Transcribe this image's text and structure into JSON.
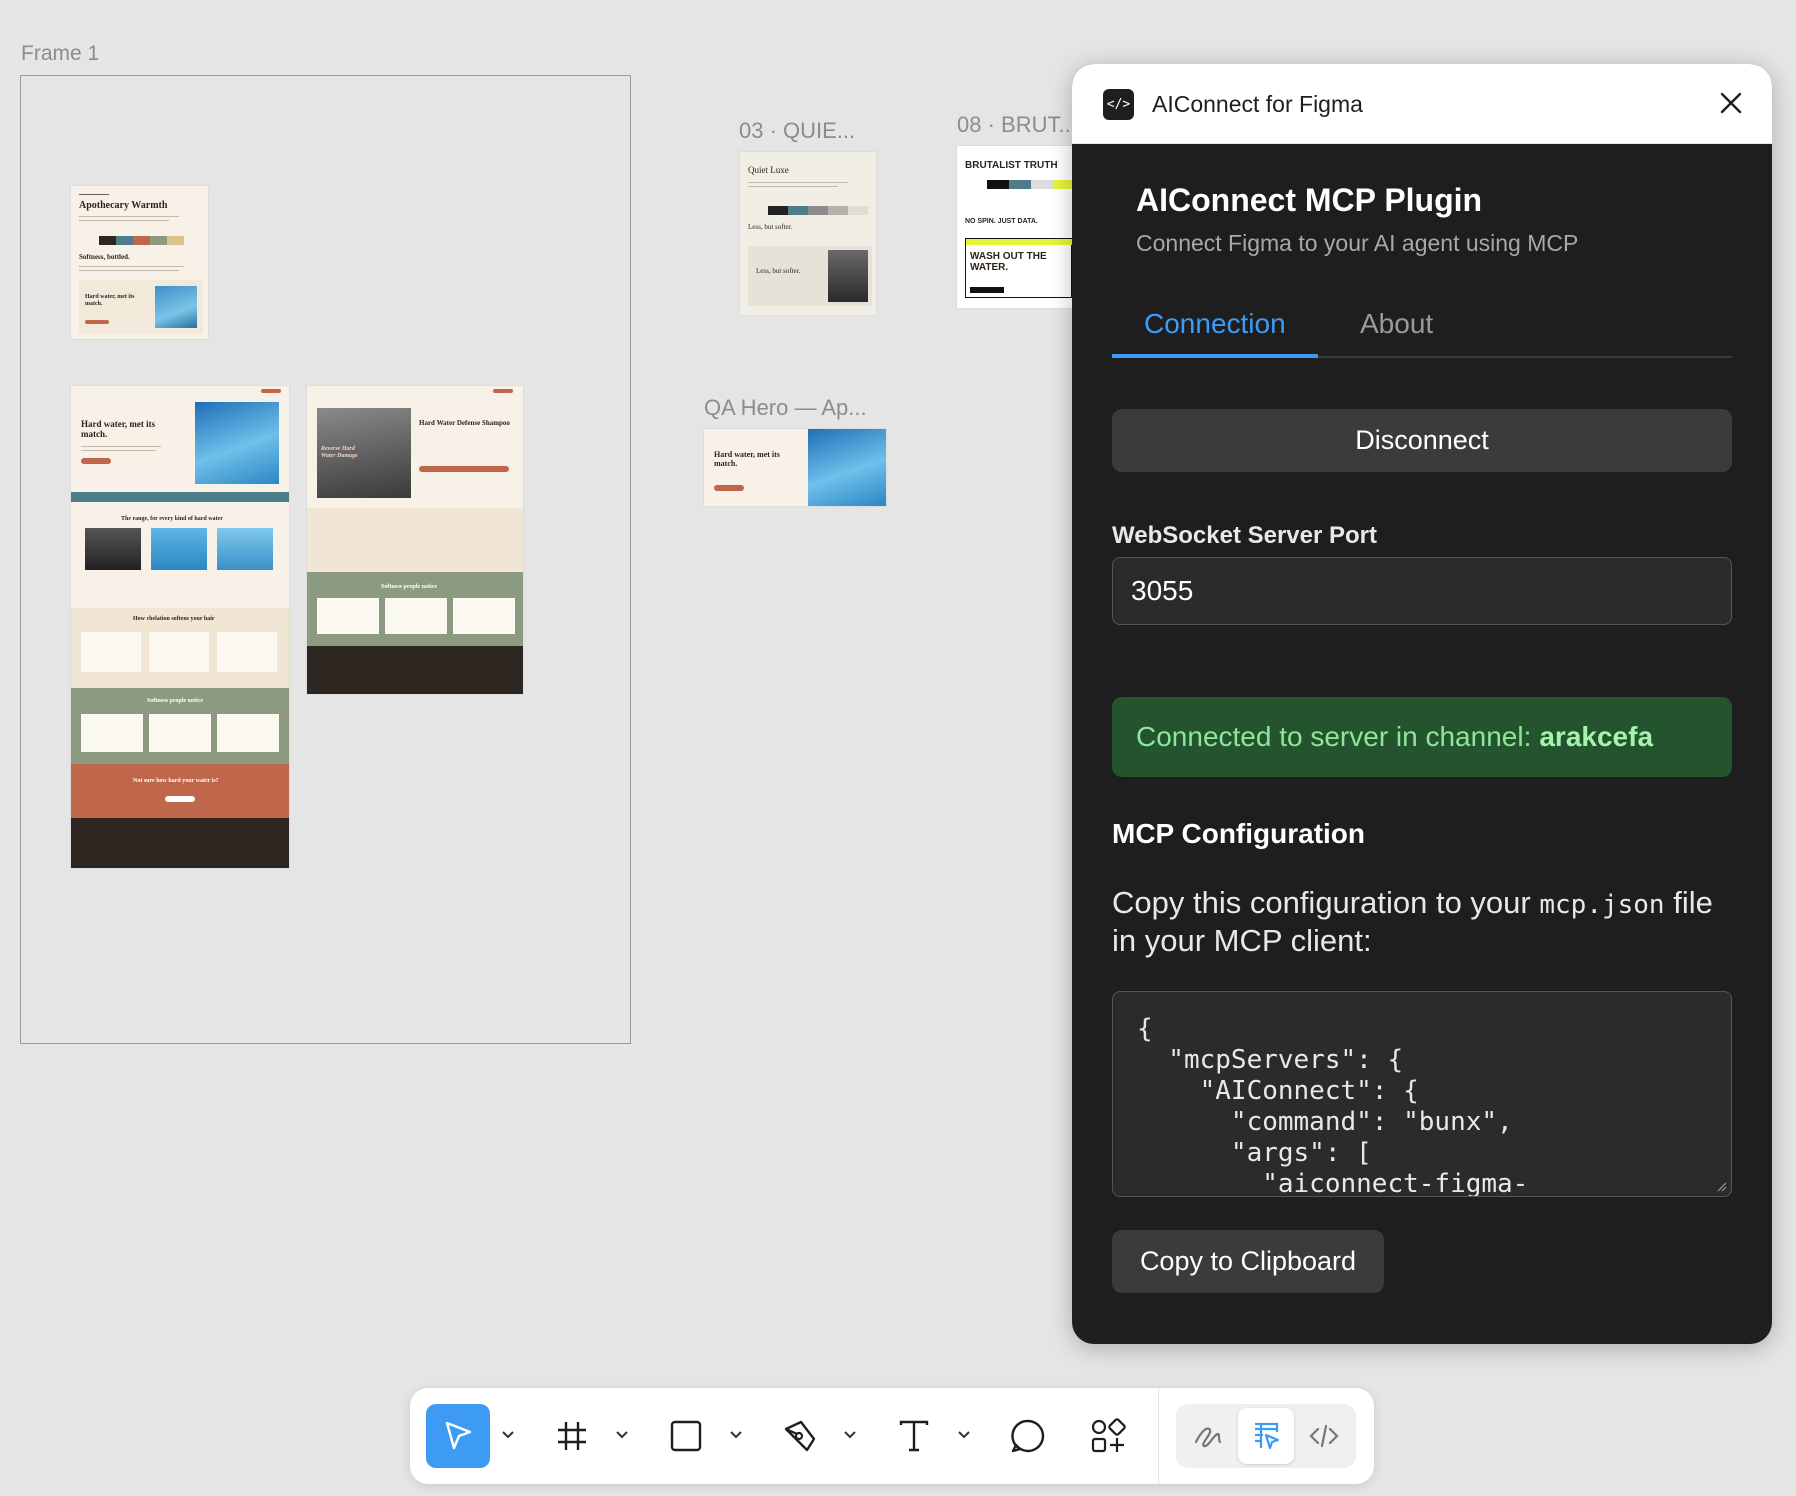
{
  "canvas": {
    "frame_label": "Frame 1",
    "frames": {
      "quiet": "03 · QUIE...",
      "brut": "08 · BRUT...",
      "qa_hero": "QA Hero — Ap..."
    },
    "thumbs": {
      "apothecary_title": "Apothecary Warmth",
      "apothecary_softness": "Softness, bottled.",
      "apothecary_hardwater": "Hard water, met its match.",
      "quiet_title": "Quiet Luxe",
      "quiet_less": "Less, but softer.",
      "brut_title": "BRUTALIST TRUTH",
      "brut_nospin": "NO SPIN. JUST DATA.",
      "brut_wash": "WASH OUT THE WATER.",
      "landing_hero": "Hard water, met its match.",
      "landing_range": "The range, for every kind of hard water",
      "landing_how": "How chelation softens your hair",
      "landing_notice": "Softness people notice",
      "landing_cta": "Not sure how hard your water is?",
      "product_title": "Hard Water Defense Shampoo",
      "product_overlay": "Reverse Hard Water Damage",
      "product_notice": "Softness people notice",
      "qa_title": "Hard water, met its match."
    },
    "palette_apothecary": [
      "#2e2620",
      "#4e7d8a",
      "#c0664a",
      "#8c9a82",
      "#d9c38a"
    ],
    "palette_quiet": [
      "#f1eee6",
      "#222222",
      "#4e7d8a",
      "#8c8c8c",
      "#b8b2a6",
      "#e0dcd2"
    ],
    "palette_brut": [
      "#ffffff",
      "#111111",
      "#4e7d8a",
      "#dddddd",
      "#e4f53a"
    ]
  },
  "plugin": {
    "window_title": "AIConnect for Figma",
    "heading": "AIConnect MCP Plugin",
    "subtitle": "Connect Figma to your AI agent using MCP",
    "tabs": [
      {
        "label": "Connection",
        "active": true
      },
      {
        "label": "About",
        "active": false
      }
    ],
    "disconnect_label": "Disconnect",
    "port_label": "WebSocket Server Port",
    "port_value": "3055",
    "status_prefix": "Connected to server in channel:",
    "status_channel": "arakcefa",
    "section_title": "MCP Configuration",
    "desc_before": "Copy this configuration to your",
    "desc_code": "mcp.json",
    "desc_after": "file in your MCP client:",
    "config_text": "{\n  \"mcpServers\": {\n    \"AIConnect\": {\n      \"command\": \"bunx\",\n      \"args\": [\n        \"aiconnect-figma-",
    "copy_label": "Copy to Clipboard",
    "accent_color": "#3d9bf5",
    "success_bg": "#24542d"
  },
  "toolbar": {
    "tools": [
      {
        "icon": "move-cursor-icon",
        "selected": true
      },
      {
        "icon": "frame-hash-icon",
        "selected": false
      },
      {
        "icon": "rectangle-icon",
        "selected": false
      },
      {
        "icon": "pen-icon",
        "selected": false
      },
      {
        "icon": "text-icon",
        "selected": false
      },
      {
        "icon": "comment-icon",
        "selected": false
      },
      {
        "icon": "actions-icon",
        "selected": false
      }
    ],
    "modes": [
      {
        "icon": "draw-icon",
        "selected": false
      },
      {
        "icon": "design-icon",
        "selected": true
      },
      {
        "icon": "dev-mode-icon",
        "selected": false
      }
    ]
  }
}
